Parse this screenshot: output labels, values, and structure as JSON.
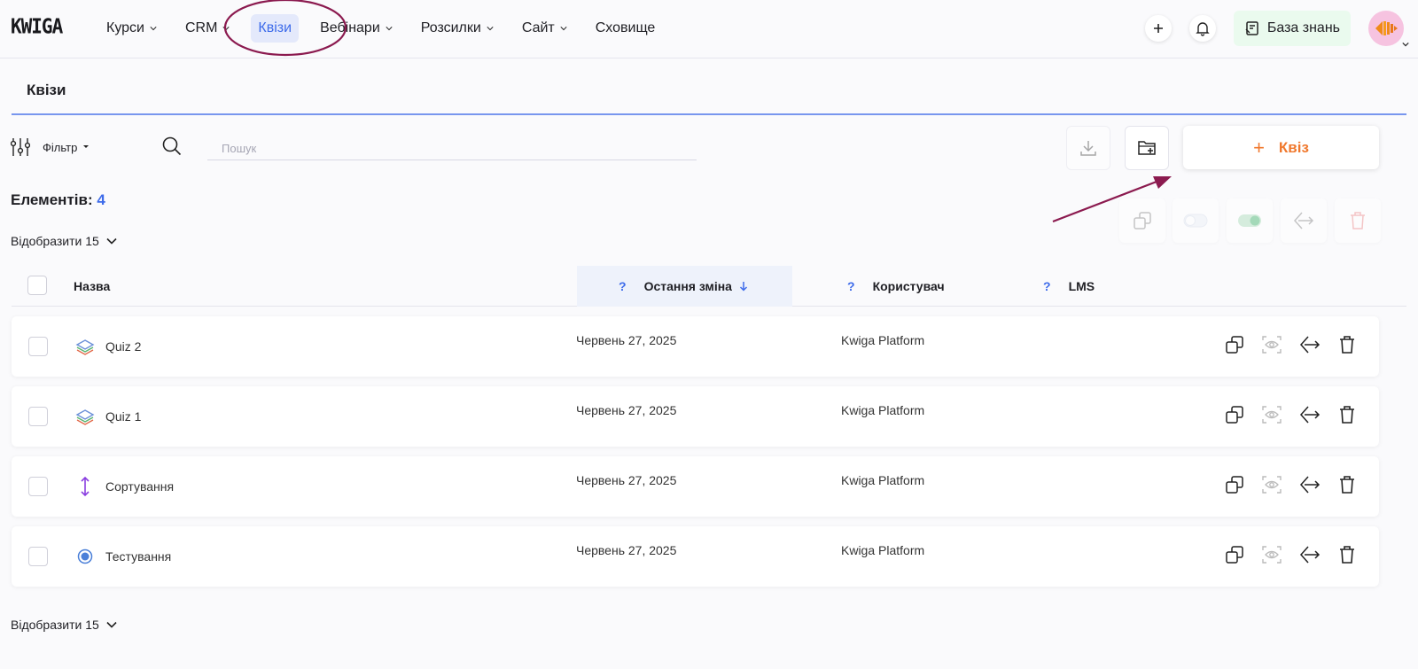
{
  "app": {
    "logo": "KWIGA"
  },
  "nav": {
    "items": [
      {
        "label": "Курси",
        "has_dropdown": true,
        "active": false
      },
      {
        "label": "CRM",
        "has_dropdown": true,
        "active": false
      },
      {
        "label": "Квізи",
        "has_dropdown": false,
        "active": true
      },
      {
        "label": "Вебінари",
        "has_dropdown": true,
        "active": false
      },
      {
        "label": "Розсилки",
        "has_dropdown": true,
        "active": false
      },
      {
        "label": "Сайт",
        "has_dropdown": true,
        "active": false
      },
      {
        "label": "Сховище",
        "has_dropdown": false,
        "active": false
      }
    ],
    "knowledge_base_label": "База знань"
  },
  "page": {
    "title": "Квізи"
  },
  "toolbar": {
    "filter_label": "Фільтр",
    "search_placeholder": "Пошук",
    "add_quiz_plus": "+",
    "add_quiz_label": "Квіз"
  },
  "summary": {
    "count_label": "Елементів:",
    "count_value": "4"
  },
  "pagination": {
    "show_label": "Відобразити 15"
  },
  "table": {
    "columns": {
      "name": "Назва",
      "last_change_q": "?",
      "last_change": "Остання зміна",
      "user_q": "?",
      "user": "Користувач",
      "lms_q": "?",
      "lms": "LMS"
    },
    "rows": [
      {
        "type_icon": "layers-icon",
        "name": "Quiz 2",
        "date": "Червень 27, 2025",
        "user": "Kwiga Platform"
      },
      {
        "type_icon": "layers-icon",
        "name": "Quiz 1",
        "date": "Червень 27, 2025",
        "user": "Kwiga Platform"
      },
      {
        "type_icon": "sort-arrows-icon",
        "name": "Сортування",
        "date": "Червень 27, 2025",
        "user": "Kwiga Platform"
      },
      {
        "type_icon": "radio-icon",
        "name": "Тестування",
        "date": "Червень 27, 2025",
        "user": "Kwiga Platform"
      }
    ]
  },
  "colors": {
    "accent": "#3d6bea",
    "orange": "#f0782d",
    "annotation": "#8b1a4f",
    "active_nav_bg": "#e4e9fb",
    "kb_bg": "#eafaee"
  }
}
